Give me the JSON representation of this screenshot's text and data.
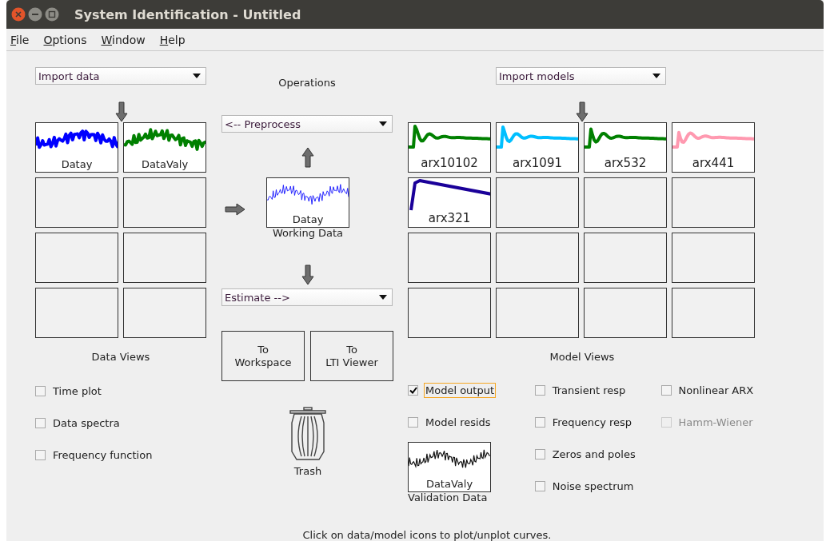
{
  "window": {
    "title": "System Identification - Untitled"
  },
  "menu": [
    {
      "label": "File"
    },
    {
      "label": "Options"
    },
    {
      "label": "Window"
    },
    {
      "label": "Help"
    }
  ],
  "data_side": {
    "import": {
      "value": "Import data"
    },
    "slots": [
      {
        "kind": "curve",
        "label": "Datay",
        "color": "#0000ff"
      },
      {
        "kind": "curve",
        "label": "DataValy",
        "color": "#008000"
      },
      {
        "kind": "empty"
      },
      {
        "kind": "empty"
      },
      {
        "kind": "empty"
      },
      {
        "kind": "empty"
      },
      {
        "kind": "empty"
      },
      {
        "kind": "empty"
      }
    ],
    "views_title": "Data Views",
    "views": [
      {
        "label": "Time plot",
        "checked": false,
        "disabled": false
      },
      {
        "label": "Data spectra",
        "checked": false,
        "disabled": false
      },
      {
        "label": "Frequency function",
        "checked": false,
        "disabled": false
      }
    ]
  },
  "operations": {
    "title": "Operations",
    "preprocess": {
      "value": "<-- Preprocess"
    },
    "working": {
      "label": "Datay",
      "caption": "Working Data"
    },
    "estimate": {
      "value": "Estimate -->"
    },
    "buttons": [
      {
        "lines": [
          "To",
          "Workspace"
        ]
      },
      {
        "lines": [
          "To",
          "LTI Viewer"
        ]
      }
    ],
    "trash": {
      "label": "Trash"
    }
  },
  "model_side": {
    "import": {
      "value": "Import models"
    },
    "slots": [
      {
        "kind": "response",
        "label": "arx10102",
        "color": "#008000"
      },
      {
        "kind": "response",
        "label": "arx1091",
        "color": "#00bfff"
      },
      {
        "kind": "response",
        "label": "arx532",
        "color": "#008000"
      },
      {
        "kind": "response",
        "label": "arx441",
        "color": "#ff99b0"
      },
      {
        "kind": "smooth",
        "label": "arx321",
        "color": "#1a0099"
      },
      {
        "kind": "empty"
      },
      {
        "kind": "empty"
      },
      {
        "kind": "empty"
      },
      {
        "kind": "empty"
      },
      {
        "kind": "empty"
      },
      {
        "kind": "empty"
      },
      {
        "kind": "empty"
      },
      {
        "kind": "empty"
      },
      {
        "kind": "empty"
      },
      {
        "kind": "empty"
      },
      {
        "kind": "empty"
      }
    ],
    "views_title": "Model Views",
    "views": [
      [
        {
          "label": "Model output",
          "checked": true,
          "disabled": false,
          "focused": true
        },
        {
          "label": "Model resids",
          "checked": false,
          "disabled": false,
          "focused": false
        }
      ],
      [
        {
          "label": "Transient resp",
          "checked": false,
          "disabled": false,
          "focused": false
        },
        {
          "label": "Frequency resp",
          "checked": false,
          "disabled": false,
          "focused": false
        },
        {
          "label": "Zeros and poles",
          "checked": false,
          "disabled": false,
          "focused": false
        },
        {
          "label": "Noise spectrum",
          "checked": false,
          "disabled": false,
          "focused": false
        }
      ],
      [
        {
          "label": "Nonlinear ARX",
          "checked": false,
          "disabled": false,
          "focused": false
        },
        {
          "label": "Hamm-Wiener",
          "checked": false,
          "disabled": true,
          "focused": false
        }
      ]
    ],
    "validation": {
      "label": "DataValy",
      "caption": "Validation Data"
    }
  },
  "status": "Click on data/model icons to plot/unplot curves."
}
